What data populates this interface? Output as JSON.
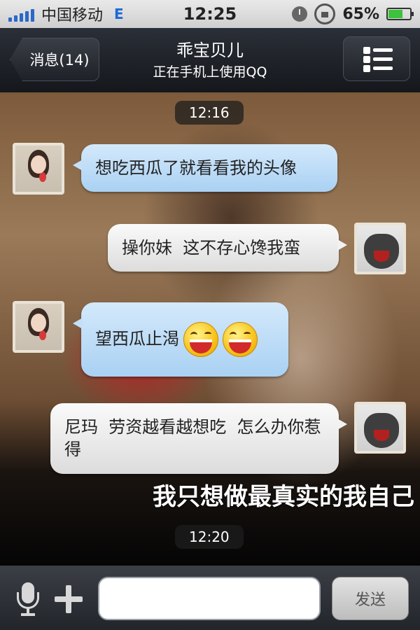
{
  "status_bar": {
    "carrier": "中国移动",
    "network": "E",
    "time": "12:25",
    "battery_percent": "65%",
    "battery_level": 0.65
  },
  "nav": {
    "back_label": "消息(14)",
    "title": "乖宝贝儿",
    "subtitle": "正在手机上使用QQ",
    "menu_icon": "list-menu-icon"
  },
  "chat": {
    "timestamps": [
      "12:16",
      "12:20"
    ],
    "watermark_text": "我只想做最真实的我自己",
    "messages": [
      {
        "side": "left",
        "text": "想吃西瓜了就看看我的头像"
      },
      {
        "side": "right",
        "text": "操你妹  这不存心馋我蛮"
      },
      {
        "side": "left",
        "text": "望西瓜止渴",
        "emoji": [
          "grin-emoji",
          "grin-emoji"
        ]
      },
      {
        "side": "right",
        "text": "尼玛  劳资越看越想吃  怎么办你惹得"
      }
    ]
  },
  "input_bar": {
    "placeholder": "",
    "send_label": "发送"
  },
  "colors": {
    "incoming_bubble": "#a9d1f3",
    "outgoing_bubble": "#dcdcdc",
    "nav_bg": "#1e2127"
  }
}
